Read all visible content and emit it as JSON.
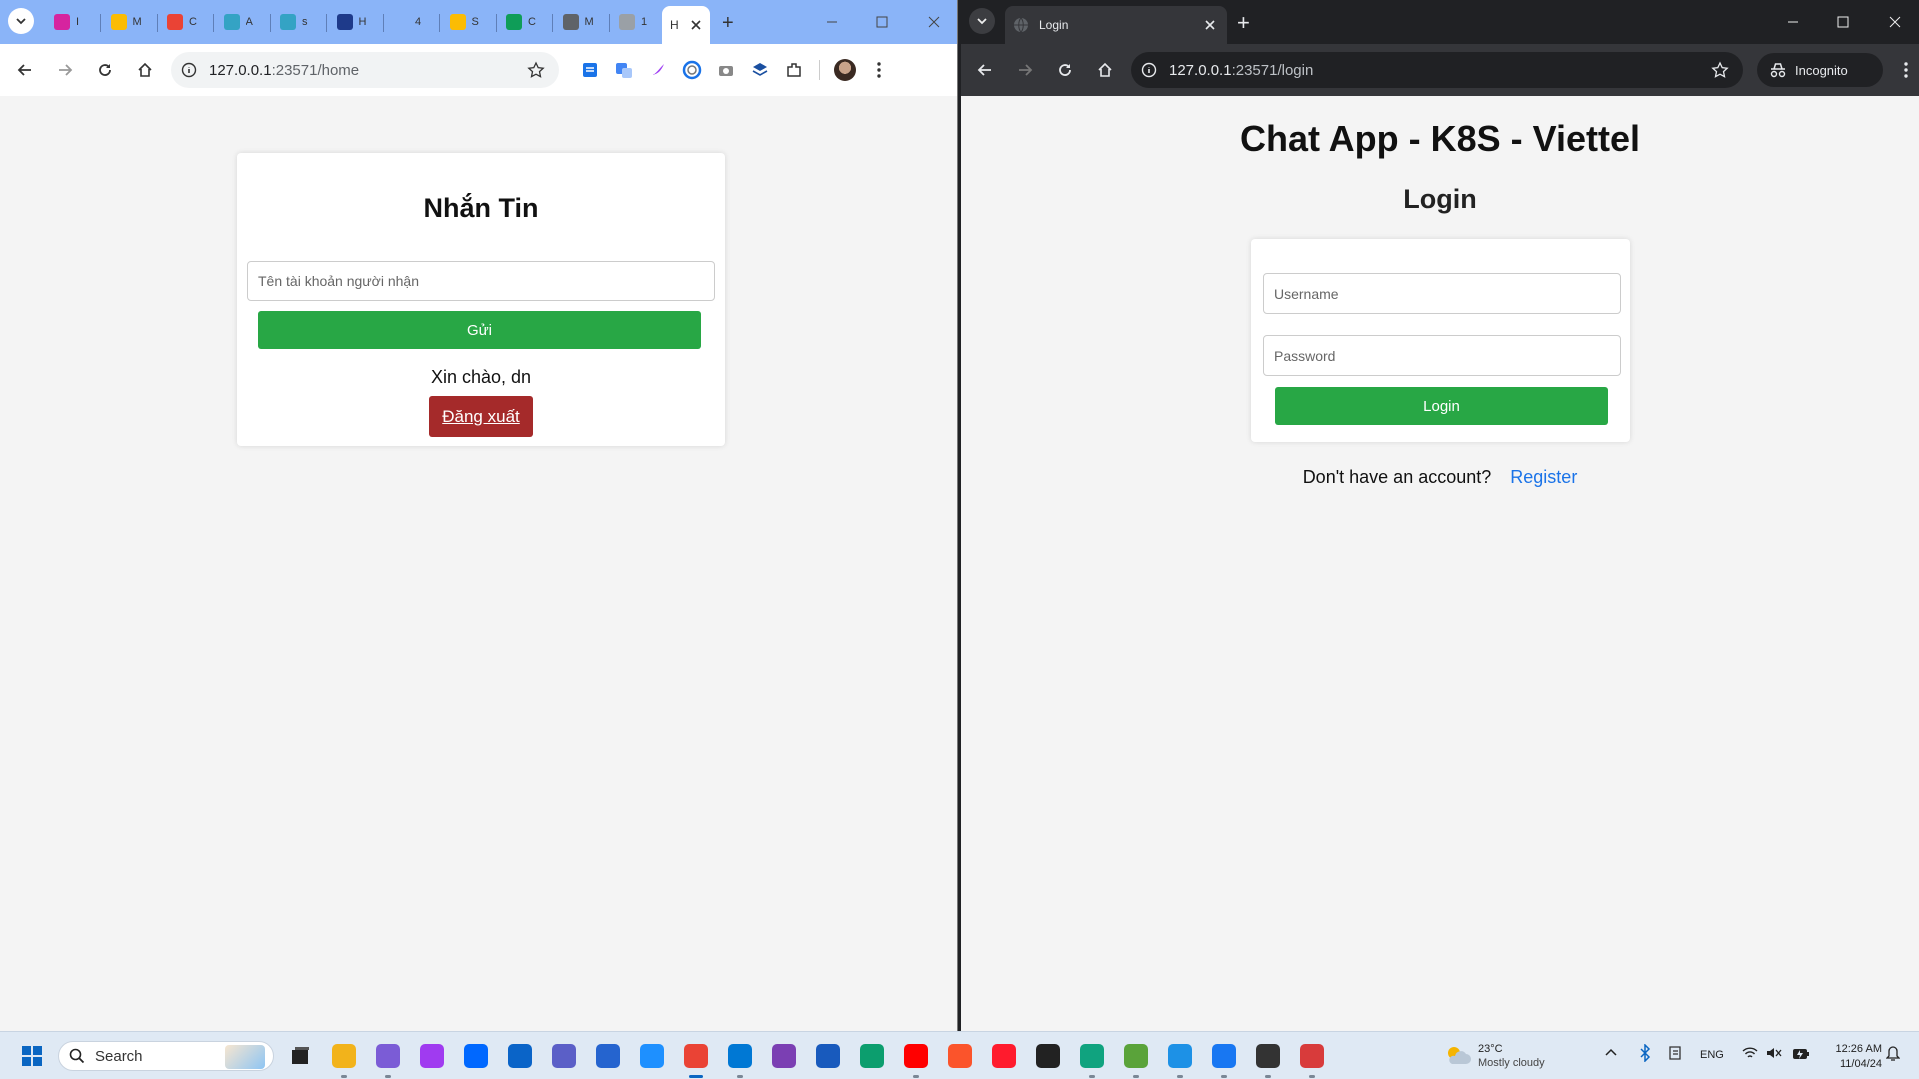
{
  "left_window": {
    "tabs": [
      {
        "label": "I",
        "color": "#d6249f"
      },
      {
        "label": "M",
        "color": "#fbbc04"
      },
      {
        "label": "C",
        "color": "#ea4335"
      },
      {
        "label": "A",
        "color": "#34a3c4"
      },
      {
        "label": "s",
        "color": "#34a3c4"
      },
      {
        "label": "H",
        "color": "#1e3a8a"
      },
      {
        "label": "4",
        "color": "#8ab4f8"
      },
      {
        "label": "S",
        "color": "#fbbc04"
      },
      {
        "label": "C",
        "color": "#0f9d58"
      },
      {
        "label": "M",
        "color": "#5f6368"
      },
      {
        "label": "1",
        "color": "#9aa0a6"
      }
    ],
    "active_tab": {
      "label": "H"
    },
    "url_host": "127.0.0.1",
    "url_path": ":23571/home",
    "page": {
      "title": "Nhắn Tin",
      "recipient_placeholder": "Tên tài khoản người nhận",
      "send_label": "Gửi",
      "greeting": "Xin chào, dn",
      "logout_label": "Đăng xuất"
    }
  },
  "right_window": {
    "tab_title": "Login",
    "url_host": "127.0.0.1",
    "url_path": ":23571/login",
    "incognito_label": "Incognito",
    "page": {
      "app_title": "Chat App - K8S - Viettel",
      "heading": "Login",
      "username_placeholder": "Username",
      "password_placeholder": "Password",
      "login_label": "Login",
      "no_account_text": "Don't have an account?",
      "register_label": "Register"
    }
  },
  "taskbar": {
    "search_placeholder": "Search",
    "weather_temp": "23°C",
    "weather_desc": "Mostly cloudy",
    "language": "ENG",
    "time": "12:26 AM",
    "date": "11/04/24",
    "apps": [
      {
        "name": "file-explorer",
        "color": "#f2b31b"
      },
      {
        "name": "copilot",
        "color": "#7b5cd6"
      },
      {
        "name": "messenger",
        "color": "#a03bf0"
      },
      {
        "name": "zalo",
        "color": "#0068ff"
      },
      {
        "name": "outlook",
        "color": "#0a64c8"
      },
      {
        "name": "teams",
        "color": "#5b5fc7"
      },
      {
        "name": "todo",
        "color": "#2564cf"
      },
      {
        "name": "safari",
        "color": "#1e90ff"
      },
      {
        "name": "chrome",
        "color": "#ea4335"
      },
      {
        "name": "vscode",
        "color": "#0078d4"
      },
      {
        "name": "visual-studio",
        "color": "#7b3fb3"
      },
      {
        "name": "word",
        "color": "#185abd"
      },
      {
        "name": "edge",
        "color": "#0c9e6e"
      },
      {
        "name": "youtube",
        "color": "#ff0000"
      },
      {
        "name": "brave",
        "color": "#fb542b"
      },
      {
        "name": "opera",
        "color": "#ff1b2d"
      },
      {
        "name": "sticky-notes",
        "color": "#222222"
      },
      {
        "name": "chatgpt",
        "color": "#10a37f"
      },
      {
        "name": "notepad",
        "color": "#5aa33a"
      },
      {
        "name": "docker",
        "color": "#1d91e6"
      },
      {
        "name": "facebook",
        "color": "#1877f2"
      },
      {
        "name": "terminal",
        "color": "#333333"
      },
      {
        "name": "snipping-tool",
        "color": "#d83b3b"
      }
    ]
  },
  "colors": {
    "accent_green": "#28a745",
    "logout_red": "#a52a2a",
    "link_blue": "#1a73e8"
  }
}
